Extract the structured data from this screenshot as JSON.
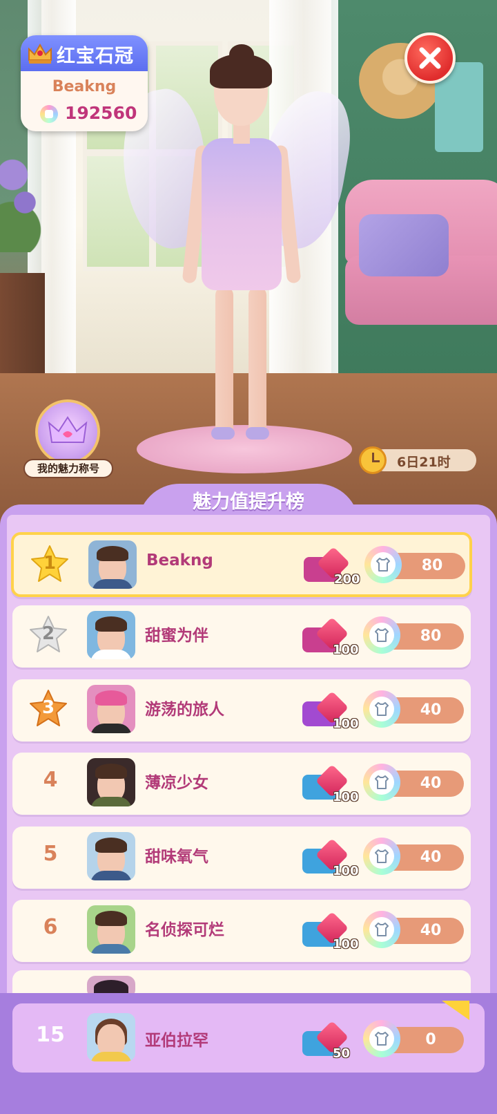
{
  "header": {
    "title_name": "红宝石冠",
    "player_name": "Beakng",
    "gem_count": "192560",
    "close_icon": "close-icon"
  },
  "charm_title": {
    "label": "我的魅力称号",
    "icon": "crown-badge-icon"
  },
  "timer": {
    "text": "6日21时",
    "icon": "clock-icon"
  },
  "leaderboard": {
    "title": "魅力值提升榜",
    "rows": [
      {
        "rank": "1",
        "name": "Beakng",
        "reward_qty": "200",
        "score": "80",
        "chest_color": "#c93f8f",
        "highlight": true
      },
      {
        "rank": "2",
        "name": "甜蜜为伴",
        "reward_qty": "100",
        "score": "80",
        "chest_color": "#c93f8f"
      },
      {
        "rank": "3",
        "name": "游荡的旅人",
        "reward_qty": "100",
        "score": "40",
        "chest_color": "#a24ad1"
      },
      {
        "rank": "4",
        "name": "薄凉少女",
        "reward_qty": "100",
        "score": "40",
        "chest_color": "#3fa3de"
      },
      {
        "rank": "5",
        "name": "甜味氧气",
        "reward_qty": "100",
        "score": "40",
        "chest_color": "#3fa3de"
      },
      {
        "rank": "6",
        "name": "名侦探可烂",
        "reward_qty": "100",
        "score": "40",
        "chest_color": "#3fa3de"
      }
    ]
  },
  "my_rank": {
    "rank": "15",
    "name": "亚伯拉罕",
    "reward_qty": "50",
    "score": "0"
  },
  "colors": {
    "panel": "#c9a1ee",
    "gold_star": "#ffd23a",
    "silver_star": "#e6e6e6",
    "bronze_star": "#f39a3a",
    "name_color": "#b23a78"
  }
}
